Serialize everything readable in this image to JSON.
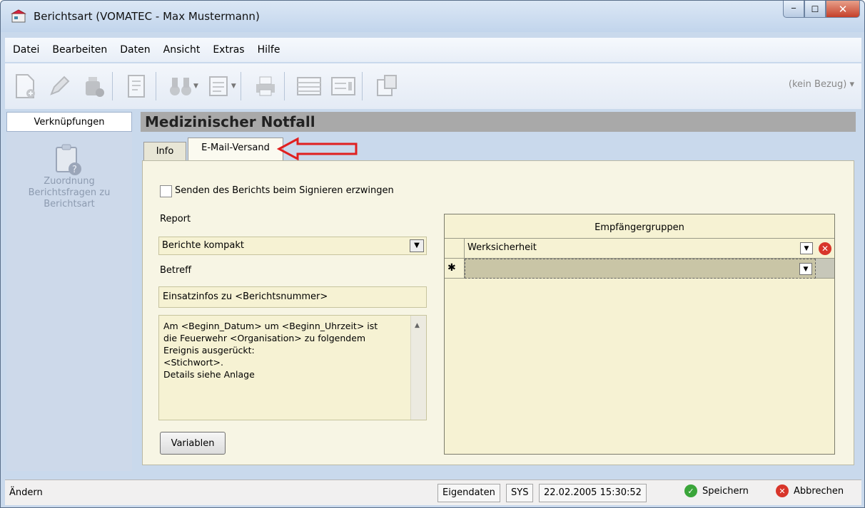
{
  "window": {
    "title": "Berichtsart (VOMATEC - Max Mustermann)",
    "minimize_label": "─",
    "maximize_label": "☐",
    "close_label": "✕"
  },
  "menu": {
    "items": [
      "Datei",
      "Bearbeiten",
      "Daten",
      "Ansicht",
      "Extras",
      "Hilfe"
    ]
  },
  "toolbar": {
    "icons": [
      "new-icon",
      "edit-icon",
      "delete-icon",
      "text-format-icon",
      "search-binoculars-icon",
      "filter-icon",
      "print-icon",
      "list-view-icon",
      "form-view-icon",
      "report-icon"
    ],
    "bezug": "(kein Bezug) ▾"
  },
  "left_panel": {
    "header": "Verknüpfungen",
    "item_label_lines": [
      "Zuordnung",
      "Berichtsfragen zu",
      "Berichtsart"
    ]
  },
  "main": {
    "title": "Medizinischer Notfall",
    "tabs": [
      {
        "label": "Info",
        "active": false
      },
      {
        "label": "E-Mail-Versand",
        "active": true
      }
    ],
    "form": {
      "checkbox_label": "Senden des Berichts beim Signieren erzwingen",
      "checkbox_checked": false,
      "report_label": "Report",
      "report_value": "Berichte kompakt",
      "betreff_label": "Betreff",
      "betreff_value": "Einsatzinfos zu <Berichtsnummer>",
      "body_lines": [
        "Am <Beginn_Datum> um <Beginn_Uhrzeit> ist",
        "die Feuerwehr <Organisation> zu folgendem",
        "Ereignis ausgerückt:",
        "<Stichwort>.",
        "Details siehe Anlage"
      ],
      "variablen_button": "Variablen"
    },
    "grid": {
      "header": "Empfängergruppen",
      "rows": [
        {
          "value": "Werksicherheit"
        }
      ],
      "new_row_marker": "✱"
    }
  },
  "status_bar": {
    "mode": "Ändern",
    "eigendaten": "Eigendaten",
    "user": "SYS",
    "timestamp": "22.02.2005 15:30:52",
    "save": "Speichern",
    "cancel": "Abbrechen"
  },
  "colors": {
    "form_background": "#f7f5e4",
    "input_background": "#f6f2d3",
    "header_grey": "#a9a9a9",
    "arrow_red": "#e02020"
  }
}
